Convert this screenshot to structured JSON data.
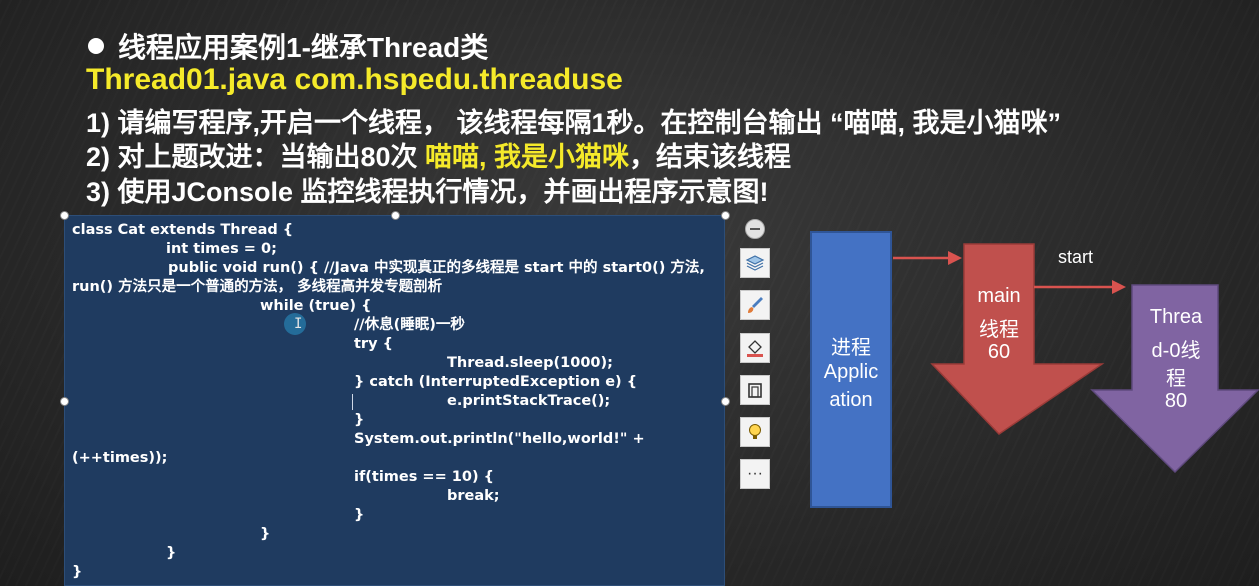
{
  "slide": {
    "title": "线程应用案例1-继承Thread类",
    "file_line": "Thread01.java com.hspedu.threaduse",
    "req1": "1) 请编写程序,开启一个线程， 该线程每隔1秒。在控制台输出 “喵喵, 我是小猫咪”",
    "req2_prefix": "2) 对上题改进：当输出80次 ",
    "req2_highlight": "喵喵, 我是小猫咪",
    "req2_suffix": "，结束该线程",
    "req3": "3) 使用JConsole 监控线程执行情况，并画出程序示意图!"
  },
  "code": [
    "class Cat extends Thread {",
    "int times = 0;",
    "public void run() { //Java 中实现真正的多线程是 start 中的 start0() 方法,",
    "run() 方法只是一个普通的方法， 多线程高并发专题剖析",
    "while (true) {",
    "//休息(睡眠)一秒",
    "try {",
    "Thread.sleep(1000);",
    "} catch (InterruptedException e) {",
    "e.printStackTrace();",
    "}",
    "System.out.println(\"hello,world!\" +",
    "(++times));",
    "if(times == 10) {",
    "break;",
    "}",
    "}",
    "}",
    "}"
  ],
  "toolbar": {
    "items": [
      "minus-icon",
      "layers-icon",
      "brush-icon",
      "fill-icon",
      "crop-icon",
      "lightbulb-icon",
      "more-icon"
    ],
    "more_label": "···"
  },
  "diagram": {
    "process_line1": "进程",
    "process_line2": "Applic",
    "process_line3": "ation",
    "main_line1": "main",
    "main_line2": "线程",
    "main_line3": "60",
    "start_label": "start",
    "thread_line1": "Threa",
    "thread_line2": "d-0线",
    "thread_line3": "程",
    "thread_line4": "80",
    "colors": {
      "process": "#4472c4",
      "main_arrow": "#c0504d",
      "thread_arrow": "#8064a2",
      "connector": "#d9534f",
      "highlight_text": "#f5ea2a",
      "code_bg": "#1f3b60"
    }
  }
}
